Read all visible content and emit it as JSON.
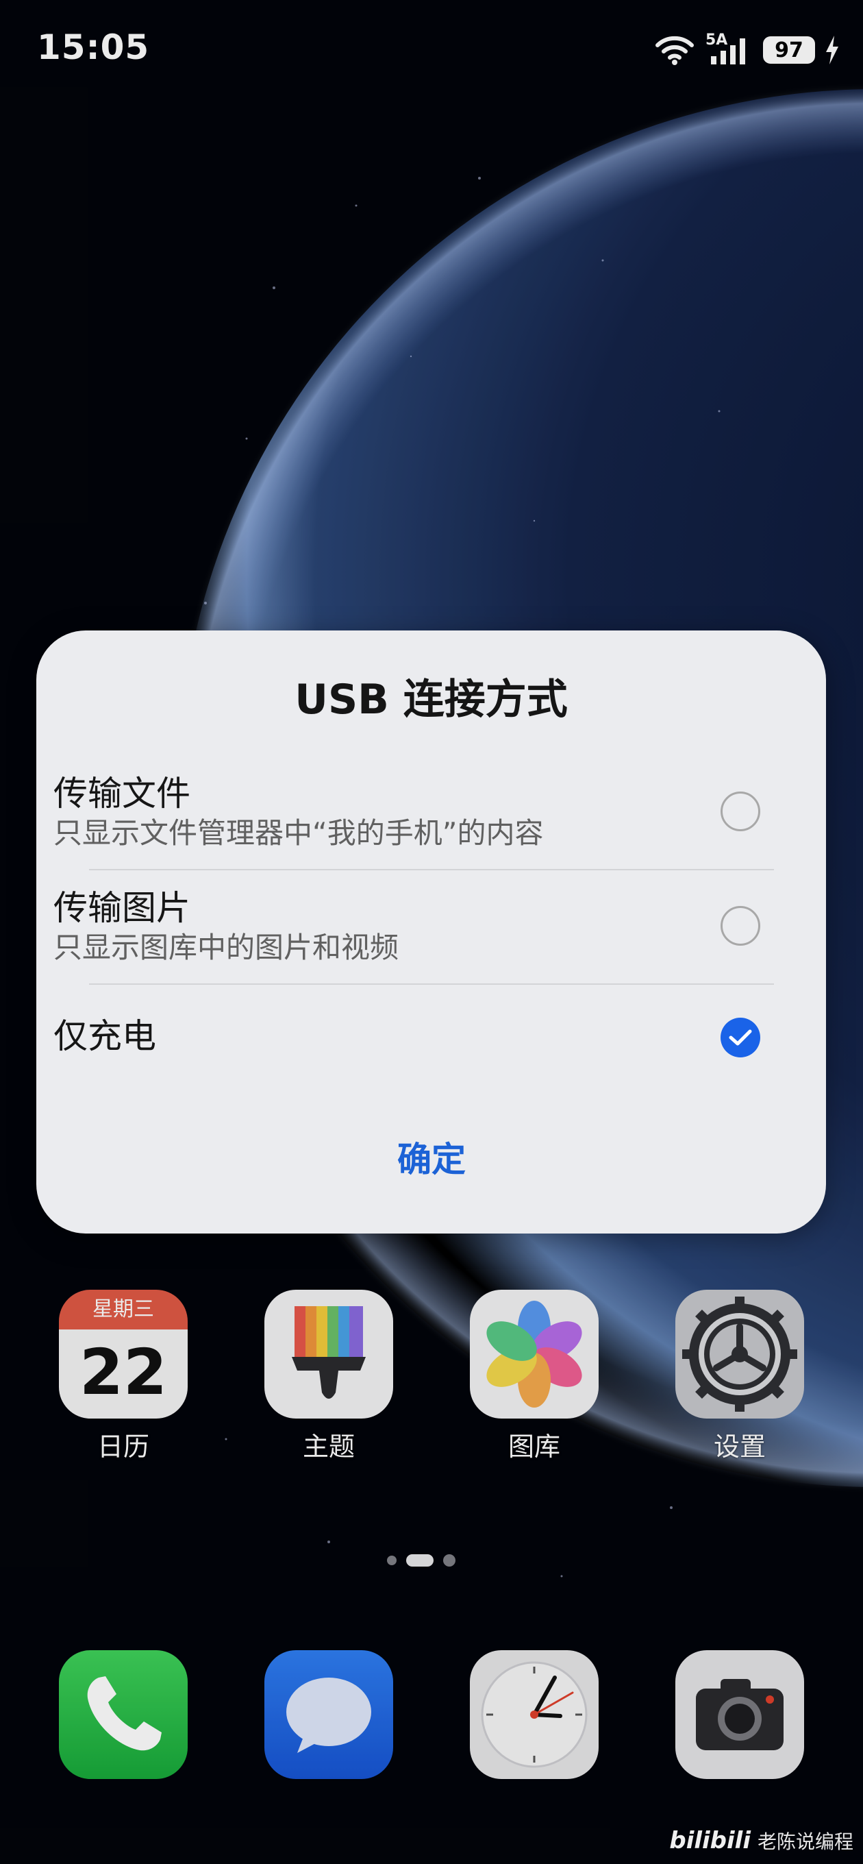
{
  "status_bar": {
    "time": "15:05",
    "network_label": "5A",
    "battery": "97",
    "icons": [
      "wifi-icon",
      "cellular-signal-icon",
      "battery-icon",
      "charging-bolt-icon"
    ]
  },
  "dialog": {
    "title": "USB 连接方式",
    "options": [
      {
        "title": "传输文件",
        "subtitle": "只显示文件管理器中“我的手机”的内容",
        "selected": false
      },
      {
        "title": "传输图片",
        "subtitle": "只显示图库中的图片和视频",
        "selected": false
      },
      {
        "title": "仅充电",
        "subtitle": "",
        "selected": true
      }
    ],
    "confirm_label": "确定",
    "accent_color": "#1a63e8"
  },
  "home_apps": [
    {
      "label": "日历",
      "icon": "calendar-icon",
      "weekday": "星期三",
      "day": "22"
    },
    {
      "label": "主题",
      "icon": "theme-brush-icon"
    },
    {
      "label": "图库",
      "icon": "gallery-flower-icon"
    },
    {
      "label": "设置",
      "icon": "settings-gear-icon"
    }
  ],
  "dock_apps": [
    {
      "icon": "phone-icon"
    },
    {
      "icon": "messages-icon"
    },
    {
      "icon": "clock-icon"
    },
    {
      "icon": "camera-icon"
    }
  ],
  "page_indicator": {
    "pages": 2,
    "current": 1
  },
  "watermark": {
    "logo": "bilibili",
    "text": "老陈说编程"
  }
}
